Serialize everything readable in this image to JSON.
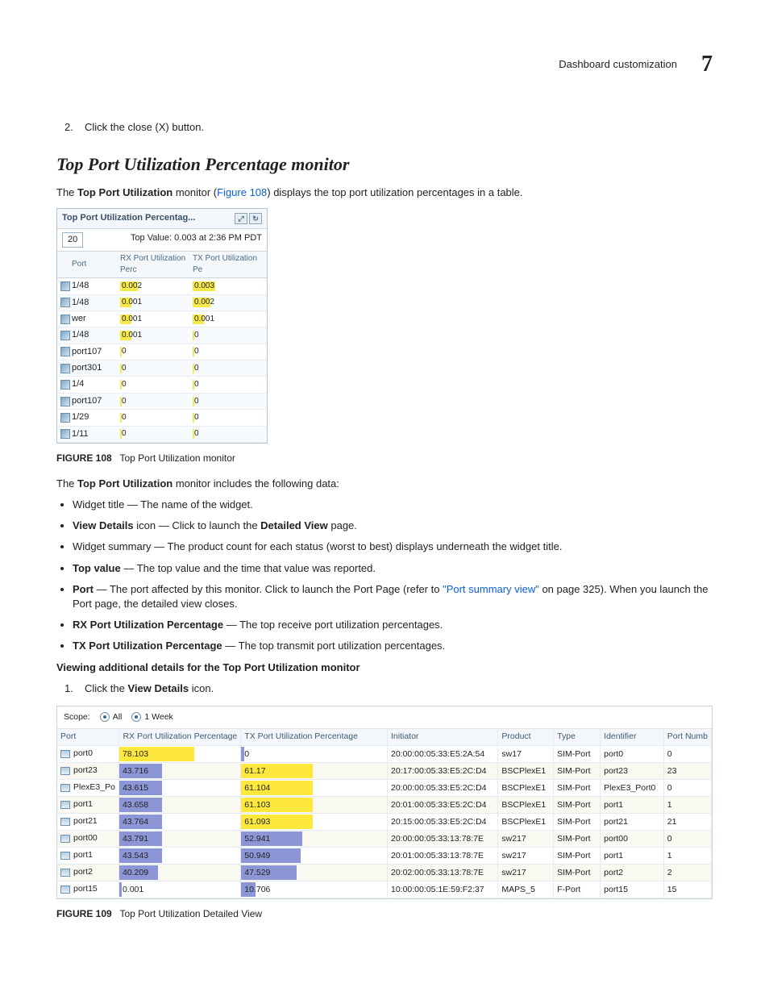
{
  "header": {
    "title": "Dashboard customization",
    "num": "7"
  },
  "step2": {
    "n": "2.",
    "text": "Click the close (X) button."
  },
  "h2": "Top Port Utilization Percentage monitor",
  "intro": {
    "t1": "The ",
    "b1": "Top Port Utilization",
    "t2": " monitor (",
    "link": "Figure 108",
    "t3": ") displays the top port utilization percentages in a table."
  },
  "widget": {
    "title": "Top Port Utilization Percentag...",
    "count": "20",
    "top_value": "Top Value: 0.003 at 2:36 PM PDT",
    "cols": {
      "port": "Port",
      "rx": "RX Port Utilization Perc",
      "tx": "TX Port Utilization Pe"
    },
    "rows": [
      {
        "port": "1/48",
        "rx": "0.002",
        "rxw": 22,
        "tx": "0.003",
        "txw": 28
      },
      {
        "port": "1/48",
        "rx": "0.001",
        "rxw": 14,
        "tx": "0.002",
        "txw": 22
      },
      {
        "port": "wer",
        "rx": "0.001",
        "rxw": 14,
        "tx": "0.001",
        "txw": 14
      },
      {
        "port": "1/48",
        "rx": "0.001",
        "rxw": 14,
        "tx": "0",
        "txw": 2
      },
      {
        "port": "port107",
        "rx": "0",
        "rxw": 2,
        "tx": "0",
        "txw": 2
      },
      {
        "port": "port301",
        "rx": "0",
        "rxw": 2,
        "tx": "0",
        "txw": 2
      },
      {
        "port": "1/4",
        "rx": "0",
        "rxw": 2,
        "tx": "0",
        "txw": 2
      },
      {
        "port": "port107",
        "rx": "0",
        "rxw": 2,
        "tx": "0",
        "txw": 2
      },
      {
        "port": "1/29",
        "rx": "0",
        "rxw": 2,
        "tx": "0",
        "txw": 2
      },
      {
        "port": "1/11",
        "rx": "0",
        "rxw": 2,
        "tx": "0",
        "txw": 2
      }
    ]
  },
  "fig108": {
    "label": "FIGURE 108",
    "caption": "Top Port Utilization monitor"
  },
  "includes": {
    "lead1": "The ",
    "lead_b": "Top Port Utilization",
    "lead2": " monitor includes the following data:"
  },
  "bullets": {
    "b1a": "Widget title — The name of the widget.",
    "b2a": "View Details",
    "b2b": " icon — Click to launch the ",
    "b2c": "Detailed View",
    "b2d": " page.",
    "b3a": "Widget summary — The product count for each status (worst to best) displays underneath the widget title.",
    "b4a": "Top value",
    "b4b": " — The top value and the time that value was reported.",
    "b5a": "Port",
    "b5b": " — The port affected by this monitor. Click to launch the Port Page (refer to ",
    "b5link": "\"Port summary view\"",
    "b5c": " on page 325). When you launch the Port page, the detailed view closes.",
    "b6a": "RX Port Utilization Percentage",
    "b6b": " — The top receive port utilization percentages.",
    "b7a": "TX Port Utilization Percentage",
    "b7b": " — The top transmit port utilization percentages."
  },
  "view_heading": "Viewing additional details for the Top Port Utilization monitor",
  "step1": {
    "n": "1.",
    "t1": "Click the ",
    "b": "View Details",
    "t2": " icon."
  },
  "detailed": {
    "scope_label": "Scope:",
    "radio1": "All",
    "radio2": "1 Week",
    "cols": {
      "port": "Port",
      "rx": "RX Port Utilization Percentage",
      "tx": "TX Port Utilization Percentage",
      "init": "Initiator",
      "prod": "Product",
      "type": "Type",
      "id": "Identifier",
      "pn": "Port Numb"
    },
    "rows": [
      {
        "port": "port0",
        "rx": "78.103",
        "rxw": 62,
        "rxc": "yellow",
        "tx": "0",
        "txw": 2,
        "txc": "blue",
        "init": "20:00:00:05:33:E5:2A:54",
        "prod": "sw17",
        "type": "SIM-Port",
        "id": "port0",
        "pn": "0"
      },
      {
        "port": "port23",
        "rx": "43.716",
        "rxw": 35,
        "rxc": "blue",
        "tx": "61.17",
        "txw": 49,
        "txc": "yellow",
        "init": "20:17:00:05:33:E5:2C:D4",
        "prod": "BSCPlexE1",
        "type": "SIM-Port",
        "id": "port23",
        "pn": "23"
      },
      {
        "port": "PlexE3_Po",
        "rx": "43.615",
        "rxw": 35,
        "rxc": "blue",
        "tx": "61.104",
        "txw": 49,
        "txc": "yellow",
        "init": "20:00:00:05:33:E5:2C:D4",
        "prod": "BSCPlexE1",
        "type": "SIM-Port",
        "id": "PlexE3_Port0",
        "pn": "0"
      },
      {
        "port": "port1",
        "rx": "43.658",
        "rxw": 35,
        "rxc": "blue",
        "tx": "61.103",
        "txw": 49,
        "txc": "yellow",
        "init": "20:01:00:05:33:E5:2C:D4",
        "prod": "BSCPlexE1",
        "type": "SIM-Port",
        "id": "port1",
        "pn": "1"
      },
      {
        "port": "port21",
        "rx": "43.764",
        "rxw": 35,
        "rxc": "blue",
        "tx": "61.093",
        "txw": 49,
        "txc": "yellow",
        "init": "20:15:00:05:33:E5:2C:D4",
        "prod": "BSCPlexE1",
        "type": "SIM-Port",
        "id": "port21",
        "pn": "21"
      },
      {
        "port": "port00",
        "rx": "43.791",
        "rxw": 35,
        "rxc": "blue",
        "tx": "52.941",
        "txw": 42,
        "txc": "blue",
        "init": "20:00:00:05:33:13:78:7E",
        "prod": "sw217",
        "type": "SIM-Port",
        "id": "port00",
        "pn": "0"
      },
      {
        "port": "port1",
        "rx": "43.543",
        "rxw": 35,
        "rxc": "blue",
        "tx": "50.949",
        "txw": 41,
        "txc": "blue",
        "init": "20:01:00:05:33:13:78:7E",
        "prod": "sw217",
        "type": "SIM-Port",
        "id": "port1",
        "pn": "1"
      },
      {
        "port": "port2",
        "rx": "40.209",
        "rxw": 32,
        "rxc": "blue",
        "tx": "47.529",
        "txw": 38,
        "txc": "blue",
        "init": "20:02:00:05:33:13:78:7E",
        "prod": "sw217",
        "type": "SIM-Port",
        "id": "port2",
        "pn": "2"
      },
      {
        "port": "port15",
        "rx": "0.001",
        "rxw": 2,
        "rxc": "blue",
        "tx": "10.706",
        "txw": 10,
        "txc": "blue",
        "init": "10:00:00:05:1E:59:F2:37",
        "prod": "MAPS_5",
        "type": "F-Port",
        "id": "port15",
        "pn": "15"
      }
    ]
  },
  "fig109": {
    "label": "FIGURE 109",
    "caption": "Top Port Utilization Detailed View"
  },
  "chart_data": [
    {
      "type": "table",
      "title": "Top Port Utilization Percentage (Figure 108 widget)",
      "categories": [
        "1/48",
        "1/48",
        "wer",
        "1/48",
        "port107",
        "port301",
        "1/4",
        "port107",
        "1/29",
        "1/11"
      ],
      "series": [
        {
          "name": "RX Port Utilization Percentage",
          "values": [
            0.002,
            0.001,
            0.001,
            0.001,
            0,
            0,
            0,
            0,
            0,
            0
          ]
        },
        {
          "name": "TX Port Utilization Percentage",
          "values": [
            0.003,
            0.002,
            0.001,
            0,
            0,
            0,
            0,
            0,
            0,
            0
          ]
        }
      ],
      "top_value": {
        "value": 0.003,
        "time": "2:36 PM PDT"
      }
    },
    {
      "type": "table",
      "title": "Top Port Utilization Detailed View (Figure 109)",
      "categories": [
        "port0",
        "port23",
        "PlexE3_Po",
        "port1",
        "port21",
        "port00",
        "port1",
        "port2",
        "port15"
      ],
      "series": [
        {
          "name": "RX Port Utilization Percentage",
          "values": [
            78.103,
            43.716,
            43.615,
            43.658,
            43.764,
            43.791,
            43.543,
            40.209,
            0.001
          ]
        },
        {
          "name": "TX Port Utilization Percentage",
          "values": [
            0,
            61.17,
            61.104,
            61.103,
            61.093,
            52.941,
            50.949,
            47.529,
            10.706
          ]
        }
      ],
      "xlabel": "Port",
      "ylabel": "Utilization %",
      "ylim": [
        0,
        100
      ]
    }
  ]
}
